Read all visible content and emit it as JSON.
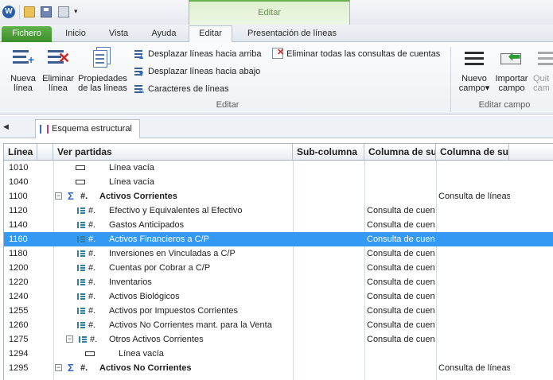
{
  "titlebar": {
    "app_icon": "W",
    "context_group_label": "Editar",
    "quick_access_icons": [
      "open-folder-icon",
      "save-icon",
      "print-icon",
      "customize-arrow-icon"
    ]
  },
  "tabs": {
    "file": "Fichero",
    "inicio": "Inicio",
    "vista": "Vista",
    "ayuda": "Ayuda",
    "editar": "Editar",
    "presentacion": "Presentación de líneas"
  },
  "ribbon": {
    "nueva_linea_1": "Nueva",
    "nueva_linea_2": "línea",
    "eliminar_linea_1": "Eliminar",
    "eliminar_linea_2": "línea",
    "propiedades_1": "Propiedades",
    "propiedades_2": "de las líneas",
    "desplazar_arriba": "Desplazar líneas hacia arriba",
    "desplazar_abajo": "Desplazar líneas hacia abajo",
    "caracteres": "Caracteres de líneas",
    "eliminar_consultas": "Eliminar todas las consultas de cuentas",
    "group_editar": "Editar",
    "nuevo_campo_1": "Nuevo",
    "nuevo_campo_2": "campo",
    "importar_campo_1": "Importar",
    "importar_campo_2": "campo",
    "quitar_campo_1": "Quit",
    "quitar_campo_2": "cam",
    "group_editar_campo": "Editar campo"
  },
  "document": {
    "tab_label": "Esquema estructural"
  },
  "grid": {
    "headers": [
      "Línea",
      "Ver partidas",
      "Sub-columna",
      "Columna de su",
      "Columna de su"
    ],
    "rows": [
      {
        "line": "1010",
        "text": "Línea vacía",
        "col1": "",
        "col2": ""
      },
      {
        "line": "1040",
        "text": "Línea vacía",
        "col1": "",
        "col2": ""
      },
      {
        "line": "1100",
        "hash": "#.",
        "text": "Activos Corrientes",
        "col1": "",
        "col2": "Consulta de líneas"
      },
      {
        "line": "1120",
        "hash": "#.",
        "text": "Efectivo y Equivalentes al Efectivo",
        "col1": "Consulta de cuen",
        "col2": ""
      },
      {
        "line": "1140",
        "hash": "#.",
        "text": "Gastos Anticipados",
        "col1": "Consulta de cuen",
        "col2": ""
      },
      {
        "line": "1160",
        "hash": "#.",
        "text": "Activos Financieros a C/P",
        "col1": "Consulta de cuen",
        "col2": ""
      },
      {
        "line": "1180",
        "hash": "#.",
        "text": "Inversiones en Vinculadas a C/P",
        "col1": "Consulta de cuen",
        "col2": ""
      },
      {
        "line": "1200",
        "hash": "#.",
        "text": "Cuentas por Cobrar a C/P",
        "col1": "Consulta de cuen",
        "col2": ""
      },
      {
        "line": "1220",
        "hash": "#.",
        "text": "Inventarios",
        "col1": "Consulta de cuen",
        "col2": ""
      },
      {
        "line": "1240",
        "hash": "#.",
        "text": "Activos Biológicos",
        "col1": "Consulta de cuen",
        "col2": ""
      },
      {
        "line": "1255",
        "hash": "#.",
        "text": "Activos por Impuestos Corrientes",
        "col1": "Consulta de cuen",
        "col2": ""
      },
      {
        "line": "1260",
        "hash": "#.",
        "text": "Activos No Corrientes mant. para la Venta",
        "col1": "Consulta de cuen",
        "col2": ""
      },
      {
        "line": "1275",
        "hash": "#.",
        "text": "Otros Activos Corrientes",
        "col1": "Consulta de cuen",
        "col2": ""
      },
      {
        "line": "1294",
        "text": "Línea vacía",
        "col1": "",
        "col2": ""
      },
      {
        "line": "1295",
        "hash": "#.",
        "text": "Activos No Corrientes",
        "col1": "",
        "col2": "Consulta de líneas"
      }
    ]
  }
}
